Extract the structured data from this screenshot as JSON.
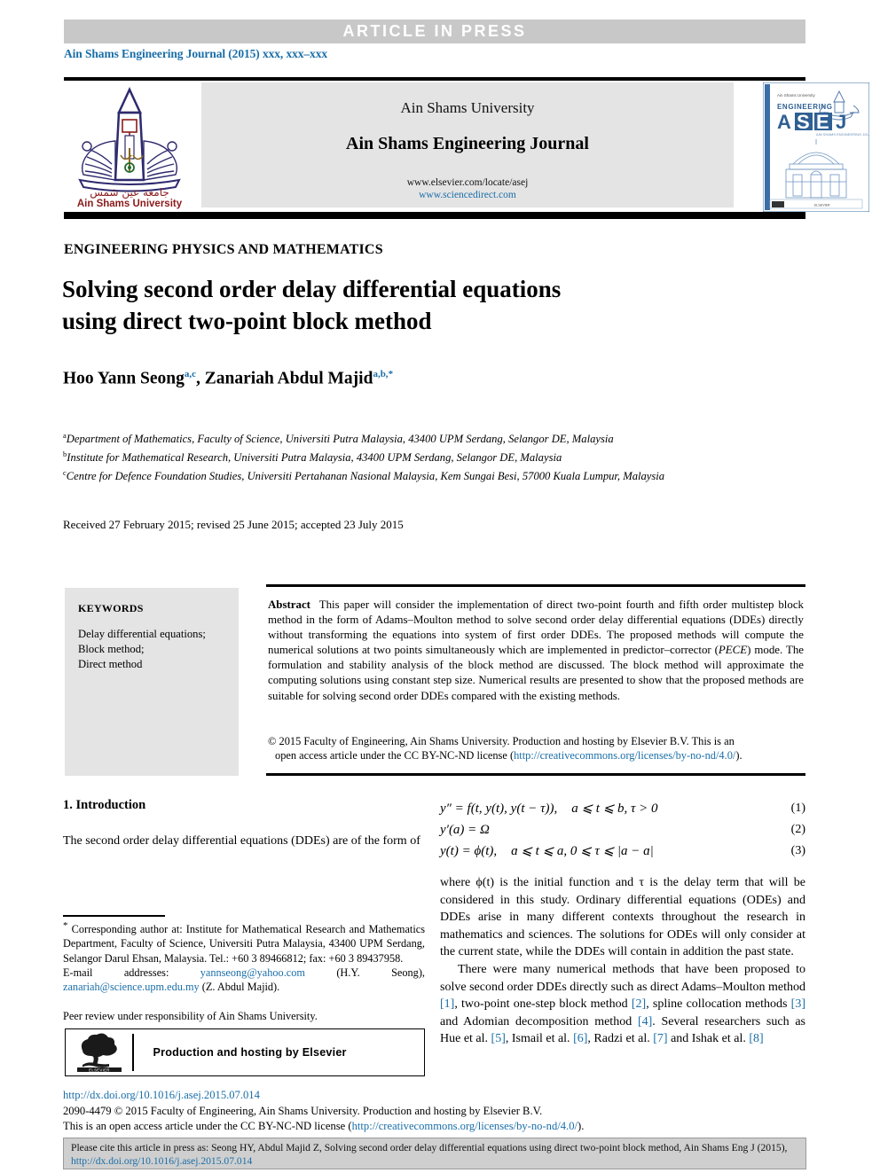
{
  "banner": {
    "text": "ARTICLE  IN  PRESS",
    "bg": "#c8c8c8",
    "color": "#ffffff"
  },
  "running_head": "Ain Shams Engineering Journal (2015) xxx, xxx–xxx",
  "masthead": {
    "university": "Ain Shams University",
    "journal": "Ain Shams Engineering Journal",
    "url_elsevier": "www.elsevier.com/locate/asej",
    "url_sciencedirect": "www.sciencedirect.com",
    "logo_caption_arabic": "جامعة عين شمس",
    "logo_caption": "Ain Shams University",
    "cover": {
      "masthead_small": "Ain Shams University",
      "word_engineering": "ENGINEERING",
      "acronym": "ASEJ",
      "subtitle": "AIN SHAMS ENGINEERING JOURNAL"
    }
  },
  "section_label": "ENGINEERING PHYSICS AND MATHEMATICS",
  "title_line1": "Solving second order delay differential equations",
  "title_line2": "using direct two-point block method",
  "authors": [
    {
      "name": "Hoo Yann Seong",
      "marks": "a,c"
    },
    {
      "name": "Zanariah Abdul Majid",
      "marks": "a,b,"
    }
  ],
  "affiliations": [
    {
      "mark": "a",
      "text": "Department of Mathematics, Faculty of Science, Universiti Putra Malaysia, 43400 UPM Serdang, Selangor DE, Malaysia"
    },
    {
      "mark": "b",
      "text": "Institute for Mathematical Research, Universiti Putra Malaysia, 43400 UPM Serdang, Selangor DE, Malaysia"
    },
    {
      "mark": "c",
      "text": "Centre for Defence Foundation Studies, Universiti Pertahanan Nasional Malaysia, Kem Sungai Besi, 57000 Kuala Lumpur, Malaysia"
    }
  ],
  "history": "Received 27 February 2015; revised 25 June 2015; accepted 23 July 2015",
  "keywords": {
    "heading": "KEYWORDS",
    "items": "Delay differential equations;\nBlock method;\nDirect method"
  },
  "abstract": {
    "label": "Abstract",
    "body_part1": "This paper will consider the implementation of direct two-point fourth and fifth order multistep block method in the form of Adams–Moulton method to solve second order delay differential equations (DDEs) directly without transforming the equations into system of first order DDEs. The proposed methods will compute the numerical solutions at two points simultaneously which are implemented in predictor–corrector (",
    "italic_term": "PECE",
    "body_part2": ") mode. The formulation and stability analysis of the block method are discussed. The block method will approximate the computing solutions using constant step size. Numerical results are presented to show that the proposed methods are suitable for solving second order DDEs compared with the existing methods."
  },
  "copyright": {
    "line1": "© 2015 Faculty of Engineering, Ain Shams University. Production and hosting by Elsevier B.V. This is an",
    "line2_pre": "open access article under the CC BY-NC-ND license (",
    "line2_link": "http://creativecommons.org/licenses/by-no-nd/4.0/",
    "line2_post": ")."
  },
  "intro": {
    "heading": "1. Introduction",
    "para1": "The second order delay differential equations (DDEs) are of the form of"
  },
  "equations": [
    {
      "lhs": "y″ = f(t, y(t), y(t − τ)),",
      "cond": "a ⩽ t ⩽ b, τ > 0",
      "number": "(1)"
    },
    {
      "lhs": "y′(a) = Ω",
      "cond": "",
      "number": "(2)"
    },
    {
      "lhs": "y(t) = ϕ(t),",
      "cond": "ɑ ⩽ t ⩽ a,   0 ⩽ τ ⩽ |a − ɑ|",
      "number": "(3)"
    }
  ],
  "right_column": {
    "para_where": "where ϕ(t) is the initial function and τ is the delay term that will be considered in this study. Ordinary differential equations (ODEs) and DDEs arise in many different contexts throughout the research in mathematics and sciences. The solutions for ODEs will only consider at the current state, while the DDEs will contain in addition the past state.",
    "para_methods_1": "There were many numerical methods that have been proposed to solve second order DDEs directly such as direct Adams–Moulton method ",
    "ref1": "[1]",
    "para_methods_2": ", two-point one-step block method ",
    "ref2": "[2]",
    "para_methods_3": ", spline collocation methods ",
    "ref3": "[3]",
    "para_methods_4": " and Adomian decomposition method ",
    "ref4": "[4]",
    "para_methods_5": ". Several researchers such as Hue et al. ",
    "ref5": "[5]",
    "para_methods_6": ", Ismail et al. ",
    "ref6": "[6]",
    "para_methods_7": ", Radzi et al. ",
    "ref7": "[7]",
    "para_methods_8": " and Ishak et al. ",
    "ref8": "[8]"
  },
  "footnote": {
    "star": "*",
    "corresponding": "Corresponding author at: Institute for Mathematical Research and Mathematics Department, Faculty of Science, Universiti Putra Malaysia, 43400 UPM Serdang, Selangor Darul Ehsan, Malaysia. Tel.: +60 3 89466812; fax: +60 3 89437958.",
    "email_label": "E-mail addresses:",
    "email1": "yannseong@yahoo.com",
    "email1_owner": "(H.Y. Seong),",
    "email2": "zanariah@science.upm.edu.my",
    "email2_owner": "(Z. Abdul Majid).",
    "peer_review": "Peer review under responsibility of Ain Shams University."
  },
  "production_box": {
    "logo_word": "ELSEVIER",
    "text": "Production and hosting by Elsevier"
  },
  "footer": {
    "doi": "http://dx.doi.org/10.1016/j.asej.2015.07.014",
    "issn_line": "2090-4479 © 2015 Faculty of Engineering, Ain Shams University. Production and hosting by Elsevier B.V.",
    "license_pre": "This is an open access article under the CC BY-NC-ND license (",
    "license_link": "http://creativecommons.org/licenses/by-no-nd/4.0/",
    "license_post": ")."
  },
  "cite_box": {
    "text_pre": "Please cite this article in press as: Seong HY, Abdul Majid Z, Solving second order delay differential equations using direct two-point block method, Ain Shams Eng J (2015), ",
    "link": "http://dx.doi.org/10.1016/j.asej.2015.07.014"
  },
  "colors": {
    "link": "#1a6ea8",
    "banner_bg": "#c8c8c8",
    "panel_bg": "#e4e4e4",
    "cite_bg": "#cfcfcf"
  }
}
